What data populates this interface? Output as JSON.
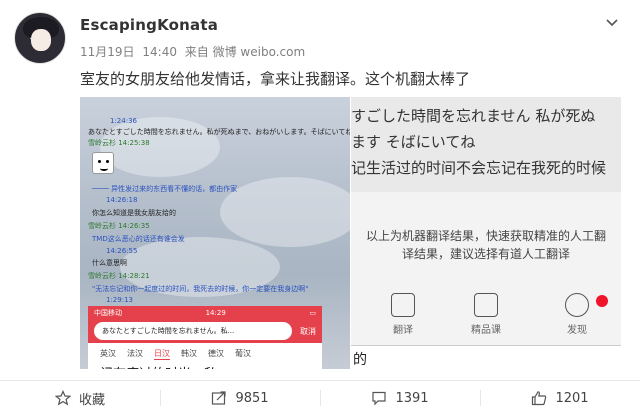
{
  "user": {
    "name": "EscapingKonata"
  },
  "meta": {
    "date": "11月19日",
    "time": "14:40",
    "source": "来自 微博 weibo.com"
  },
  "post": {
    "text": "室友的女朋友给他发情话，拿来让我翻译。这个机翻太棒了"
  },
  "image_left": {
    "messages": [
      {
        "text": "1:24:36",
        "style": "blue"
      },
      {
        "text": "あなたとすごした時間を忘れません。私が死ぬまで、おねがいします。そばにいてね",
        "style": "dark"
      },
      {
        "text": "雪岭云杉  14:25:38",
        "style": "green"
      },
      {
        "text": "──── 异性发过来的东西看不懂的话，都由作家",
        "style": "blue"
      },
      {
        "text": "14:26:18",
        "style": "blue"
      },
      {
        "text": "你怎么知道是我女朋友给的",
        "style": "dark"
      },
      {
        "text": "雪岭云杉  14:26:35",
        "style": "green"
      },
      {
        "text": "TMD这么恶心的话还有谁会发",
        "style": "blue"
      },
      {
        "text": "14:26:55",
        "style": "blue"
      },
      {
        "text": "什么意思啊",
        "style": "dark"
      },
      {
        "text": "雪岭云杉  14:28:21",
        "style": "green"
      },
      {
        "text": "\"无法忘记和你一起度过的时间，我死去的时候，你一定要在我身边啊\"",
        "style": "blue"
      },
      {
        "text": "1:29:13",
        "style": "blue"
      }
    ],
    "status_bar": {
      "carrier": "中国移动",
      "time": "14:29"
    },
    "search_text": "あなたとすごした時間を忘れません。私...",
    "cancel_label": "取消",
    "lang_tabs": [
      "英汉",
      "法汉",
      "日汉",
      "韩汉",
      "德汉",
      "葡汉"
    ],
    "active_tab": "日汉",
    "overflow_text": "记有度过的时光，私..."
  },
  "image_right": {
    "jp_line1": "すごした時間を忘れません 私が死ぬ",
    "jp_line2": "ます そばにいてね",
    "cn_line": "记生活过的时间不会忘记在我死的时候",
    "note_line1": "以上为机器翻译结果，快速获取精准的人工翻",
    "note_line2": "译结果，建议选择有道人工翻译",
    "tools": [
      {
        "label": "翻译",
        "icon": "translate-icon"
      },
      {
        "label": "精品课",
        "icon": "play-course-icon"
      },
      {
        "label": "发现",
        "icon": "compass-icon"
      }
    ],
    "bottom_text": "的"
  },
  "actions": [
    {
      "label": "收藏",
      "icon": "star-icon"
    },
    {
      "label": "9851",
      "icon": "share-icon"
    },
    {
      "label": "1391",
      "icon": "comment-icon"
    },
    {
      "label": "1201",
      "icon": "like-icon"
    }
  ],
  "colors": {
    "accent": "#e5414c",
    "link": "#2a52be",
    "badge": "#f0132a"
  }
}
